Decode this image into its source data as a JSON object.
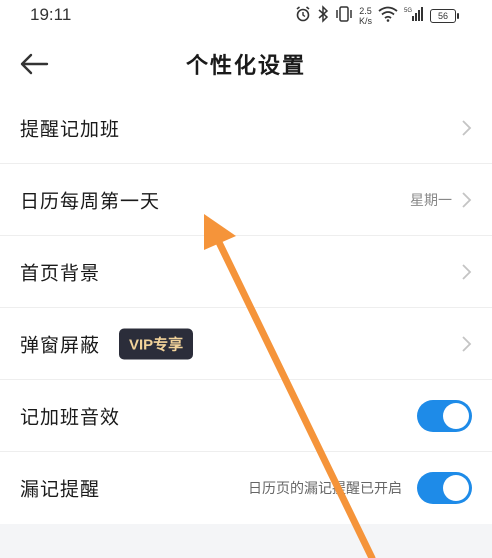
{
  "status_bar": {
    "time": "19:11",
    "net_speed_value": "2.5",
    "net_speed_unit": "K/s",
    "battery": "56",
    "icons": [
      "alarm-icon",
      "bluetooth-icon",
      "vibrate-icon",
      "wifi-icon",
      "signal-icon",
      "battery-icon"
    ]
  },
  "header": {
    "title": "个性化设置",
    "back_icon": "back-arrow-icon"
  },
  "settings": {
    "overtime_reminder": {
      "label": "提醒记加班"
    },
    "week_start": {
      "label": "日历每周第一天",
      "value": "星期一"
    },
    "home_background": {
      "label": "首页背景"
    },
    "popup_block": {
      "label": "弹窗屏蔽",
      "badge": "VIP专享"
    },
    "overtime_sound": {
      "label": "记加班音效",
      "enabled": true
    },
    "missed_reminder": {
      "label": "漏记提醒",
      "note": "日历页的漏记提醒已开启",
      "enabled": true
    }
  },
  "colors": {
    "toggle_on": "#1e8be8",
    "vip_badge_bg": "#2b2d3a",
    "vip_badge_text": "#f2d39a",
    "annotation_arrow": "#f5943a"
  }
}
